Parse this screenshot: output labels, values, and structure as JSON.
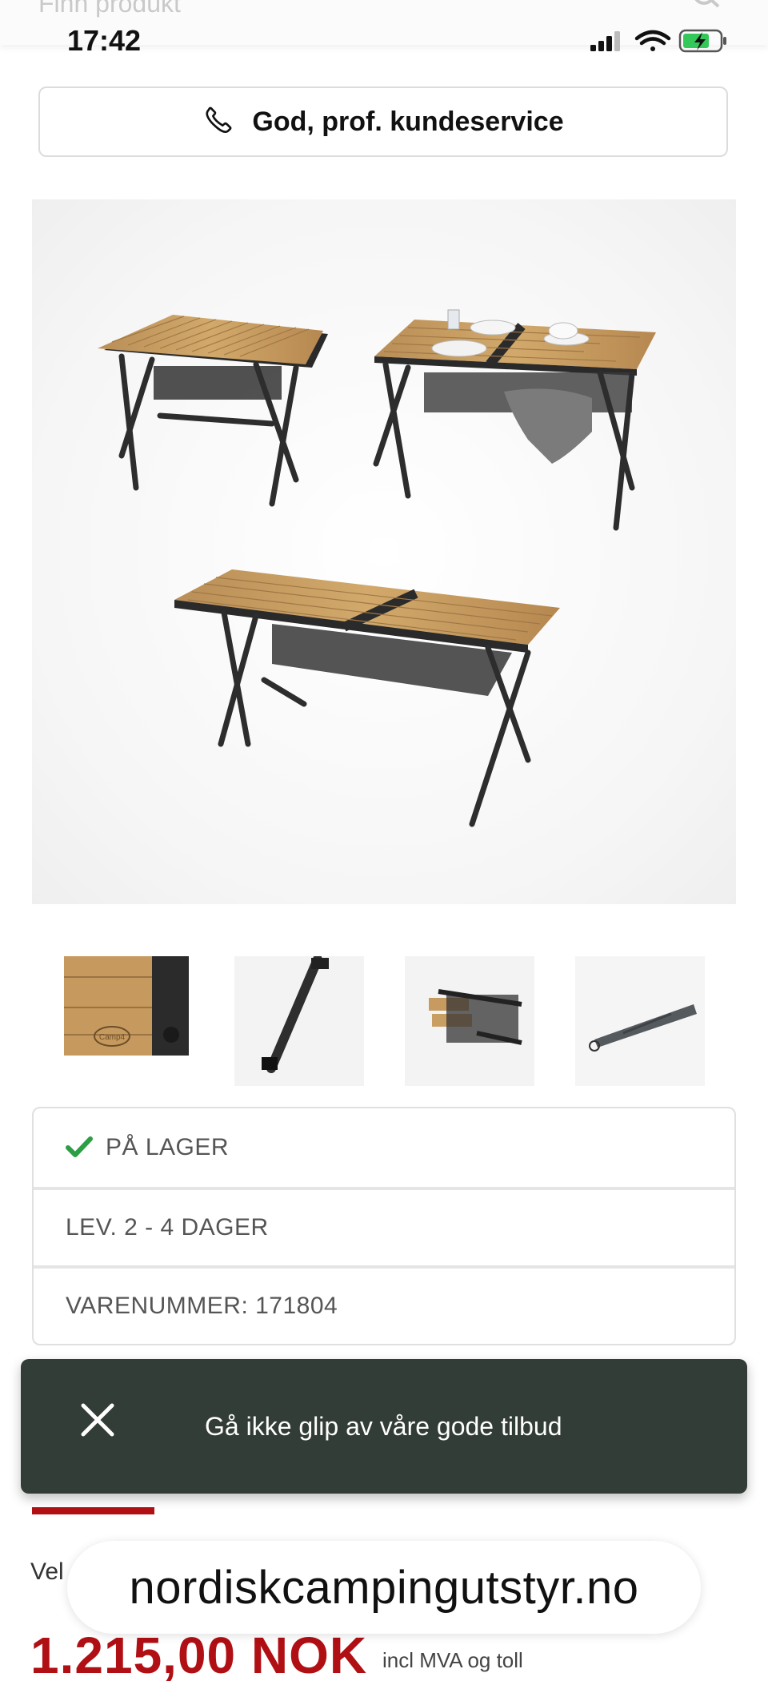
{
  "header": {
    "search_placeholder": "Finn produkt",
    "time": "17:42"
  },
  "service_bar": {
    "label": "God, prof. kundeservice"
  },
  "gallery": {
    "main_image": "bamboo-camping-table-product-photo",
    "thumbnails": [
      {
        "name": "thumb-tabletop-closeup"
      },
      {
        "name": "thumb-table-leg"
      },
      {
        "name": "thumb-table-parts"
      },
      {
        "name": "thumb-carry-bag"
      }
    ],
    "thumb_logo_text": "Camp4"
  },
  "info": {
    "stock": "PÅ LAGER",
    "delivery": "LEV. 2 - 4 DAGER",
    "sku": "VARENUMMER: 171804"
  },
  "toast": {
    "message": "Gå ikke glip av våre gode tilbud"
  },
  "product": {
    "partial_text": "Vel",
    "price": "1.215,00 NOK",
    "price_note": "incl MVA og toll"
  },
  "browser": {
    "domain": "nordiskcampingutstyr.no"
  },
  "colors": {
    "accent_red": "#b00f14",
    "toast_bg": "#333d37",
    "stock_green": "#2e9e44"
  }
}
